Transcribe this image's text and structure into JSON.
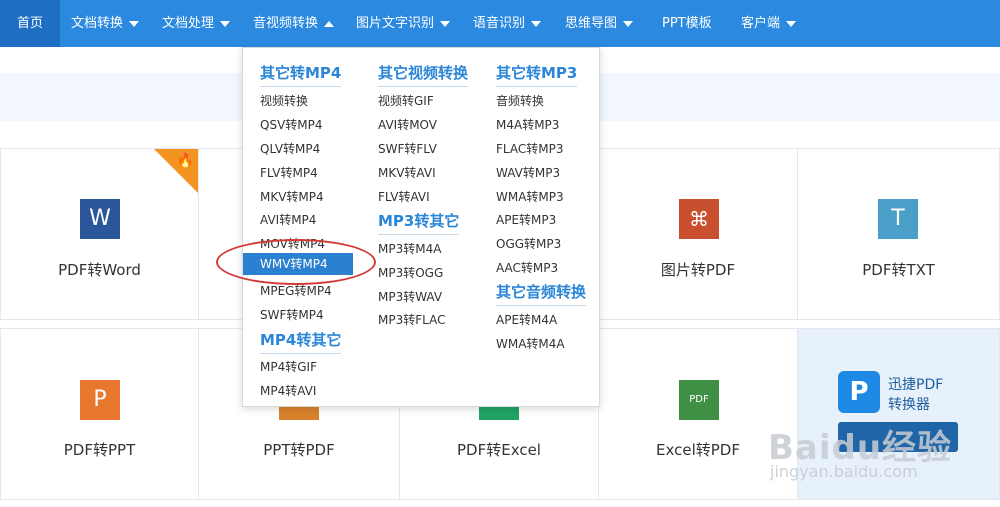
{
  "nav": {
    "items": [
      {
        "label": "首页"
      },
      {
        "label": "文档转换"
      },
      {
        "label": "文档处理"
      },
      {
        "label": "音视频转换"
      },
      {
        "label": "图片文字识别"
      },
      {
        "label": "语音识别"
      },
      {
        "label": "思维导图"
      },
      {
        "label": "PPT模板"
      },
      {
        "label": "客户端"
      }
    ]
  },
  "dropdown": {
    "col1": {
      "head1": "其它转MP4",
      "items1": [
        "视频转换",
        "QSV转MP4",
        "QLV转MP4",
        "FLV转MP4",
        "MKV转MP4",
        "AVI转MP4",
        "MOV转MP4",
        "WMV转MP4",
        "MPEG转MP4",
        "SWF转MP4"
      ],
      "head2": "MP4转其它",
      "items2": [
        "MP4转GIF",
        "MP4转AVI"
      ]
    },
    "col2": {
      "head1": "其它视频转换",
      "items1": [
        "视频转GIF",
        "AVI转MOV",
        "SWF转FLV",
        "MKV转AVI",
        "FLV转AVI"
      ],
      "head2": "MP3转其它",
      "items2": [
        "MP3转M4A",
        "MP3转OGG",
        "MP3转WAV",
        "MP3转FLAC"
      ]
    },
    "col3": {
      "head1": "其它转MP3",
      "items1": [
        "音频转换",
        "M4A转MP3",
        "FLAC转MP3",
        "WAV转MP3",
        "WMA转MP3",
        "APE转MP3",
        "OGG转MP3",
        "AAC转MP3"
      ],
      "head2": "其它音频转换",
      "items2": [
        "APE转M4A",
        "WMA转M4A"
      ]
    }
  },
  "cards": [
    {
      "label": "PDF转Word",
      "icon": "W",
      "color": "#2b579a"
    },
    {
      "label": "图片转PDF",
      "icon": "pdf-symbol",
      "color": "#c8502e"
    },
    {
      "label": "PDF转TXT",
      "icon": "T",
      "color": "#4a9fc9"
    },
    {
      "label": "PDF转PPT",
      "icon": "P",
      "color": "#e8772e"
    },
    {
      "label": "PPT转PDF",
      "icon": "",
      "color": "#d9822b"
    },
    {
      "label": "PDF转Excel",
      "icon": "",
      "color": "#21a366"
    },
    {
      "label": "Excel转PDF",
      "icon": "PDF",
      "color": "#3f8f45"
    }
  ],
  "promo": {
    "line1": "迅捷PDF",
    "line2": "转换器",
    "brand_icon": "P"
  },
  "watermark": {
    "main": "Baidu经验",
    "sub": "jingyan.baidu.com"
  }
}
